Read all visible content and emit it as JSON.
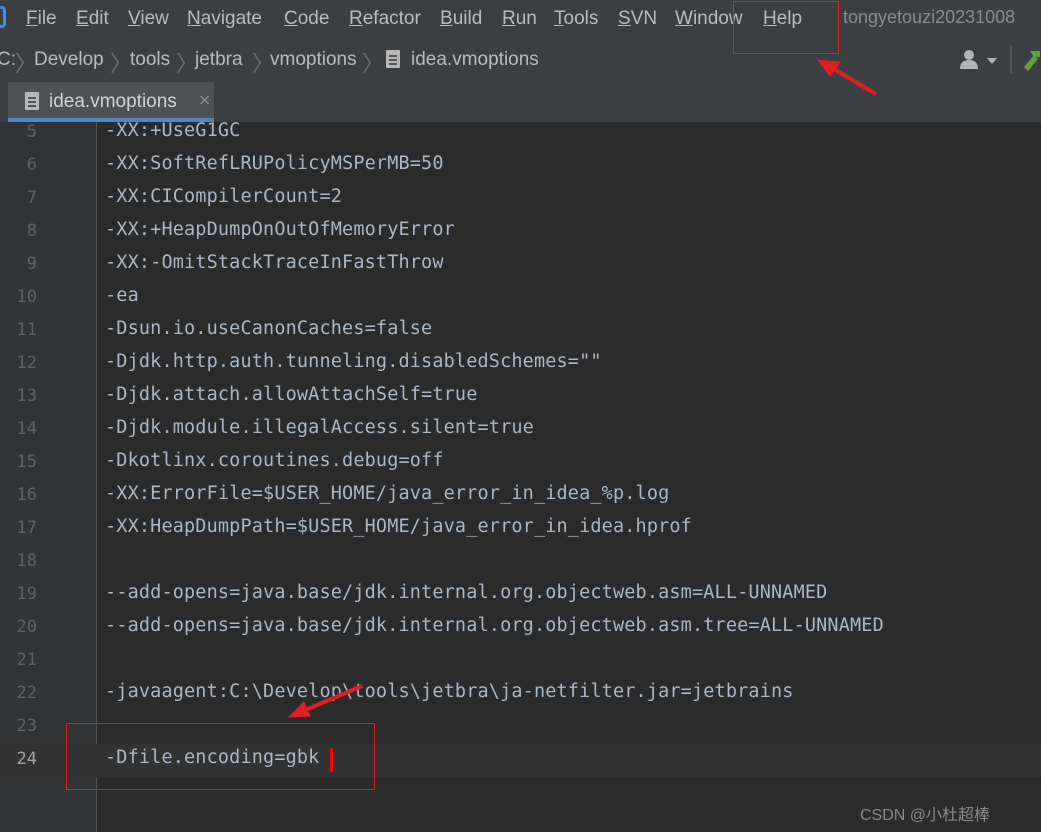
{
  "menubar": {
    "items": [
      "File",
      "Edit",
      "View",
      "Navigate",
      "Code",
      "Refactor",
      "Build",
      "Run",
      "Tools",
      "SVN",
      "Window",
      "Help"
    ],
    "username": "tongyetouzi20231008"
  },
  "breadcrumb": {
    "items": [
      "C:",
      "Develop",
      "tools",
      "jetbra",
      "vmoptions",
      "idea.vmoptions"
    ]
  },
  "tab": {
    "label": "idea.vmoptions",
    "close_icon": "×"
  },
  "editor": {
    "lines": [
      {
        "n": "5",
        "text": "-XX:+UseG1GC"
      },
      {
        "n": "6",
        "text": "-XX:SoftRefLRUPolicyMSPerMB=50"
      },
      {
        "n": "7",
        "text": "-XX:CICompilerCount=2"
      },
      {
        "n": "8",
        "text": "-XX:+HeapDumpOnOutOfMemoryError"
      },
      {
        "n": "9",
        "text": "-XX:-OmitStackTraceInFastThrow"
      },
      {
        "n": "10",
        "text": "-ea"
      },
      {
        "n": "11",
        "text": "-Dsun.io.useCanonCaches=false"
      },
      {
        "n": "12",
        "text": "-Djdk.http.auth.tunneling.disabledSchemes=\"\""
      },
      {
        "n": "13",
        "text": "-Djdk.attach.allowAttachSelf=true"
      },
      {
        "n": "14",
        "text": "-Djdk.module.illegalAccess.silent=true"
      },
      {
        "n": "15",
        "text": "-Dkotlinx.coroutines.debug=off"
      },
      {
        "n": "16",
        "text": "-XX:ErrorFile=$USER_HOME/java_error_in_idea_%p.log"
      },
      {
        "n": "17",
        "text": "-XX:HeapDumpPath=$USER_HOME/java_error_in_idea.hprof"
      },
      {
        "n": "18",
        "text": ""
      },
      {
        "n": "19",
        "text": "--add-opens=java.base/jdk.internal.org.objectweb.asm=ALL-UNNAMED"
      },
      {
        "n": "20",
        "text": "--add-opens=java.base/jdk.internal.org.objectweb.asm.tree=ALL-UNNAMED"
      },
      {
        "n": "21",
        "text": ""
      },
      {
        "n": "22",
        "text": "-javaagent:C:\\Develop\\tools\\jetbra\\ja-netfilter.jar=jetbrains"
      },
      {
        "n": "23",
        "text": ""
      },
      {
        "n": "24",
        "text": "-Dfile.encoding=gbk"
      }
    ],
    "current_line": "24"
  },
  "watermark": "CSDN @小杜超棒",
  "colors": {
    "annotation": "#e02020",
    "caret": "#ff0000"
  }
}
